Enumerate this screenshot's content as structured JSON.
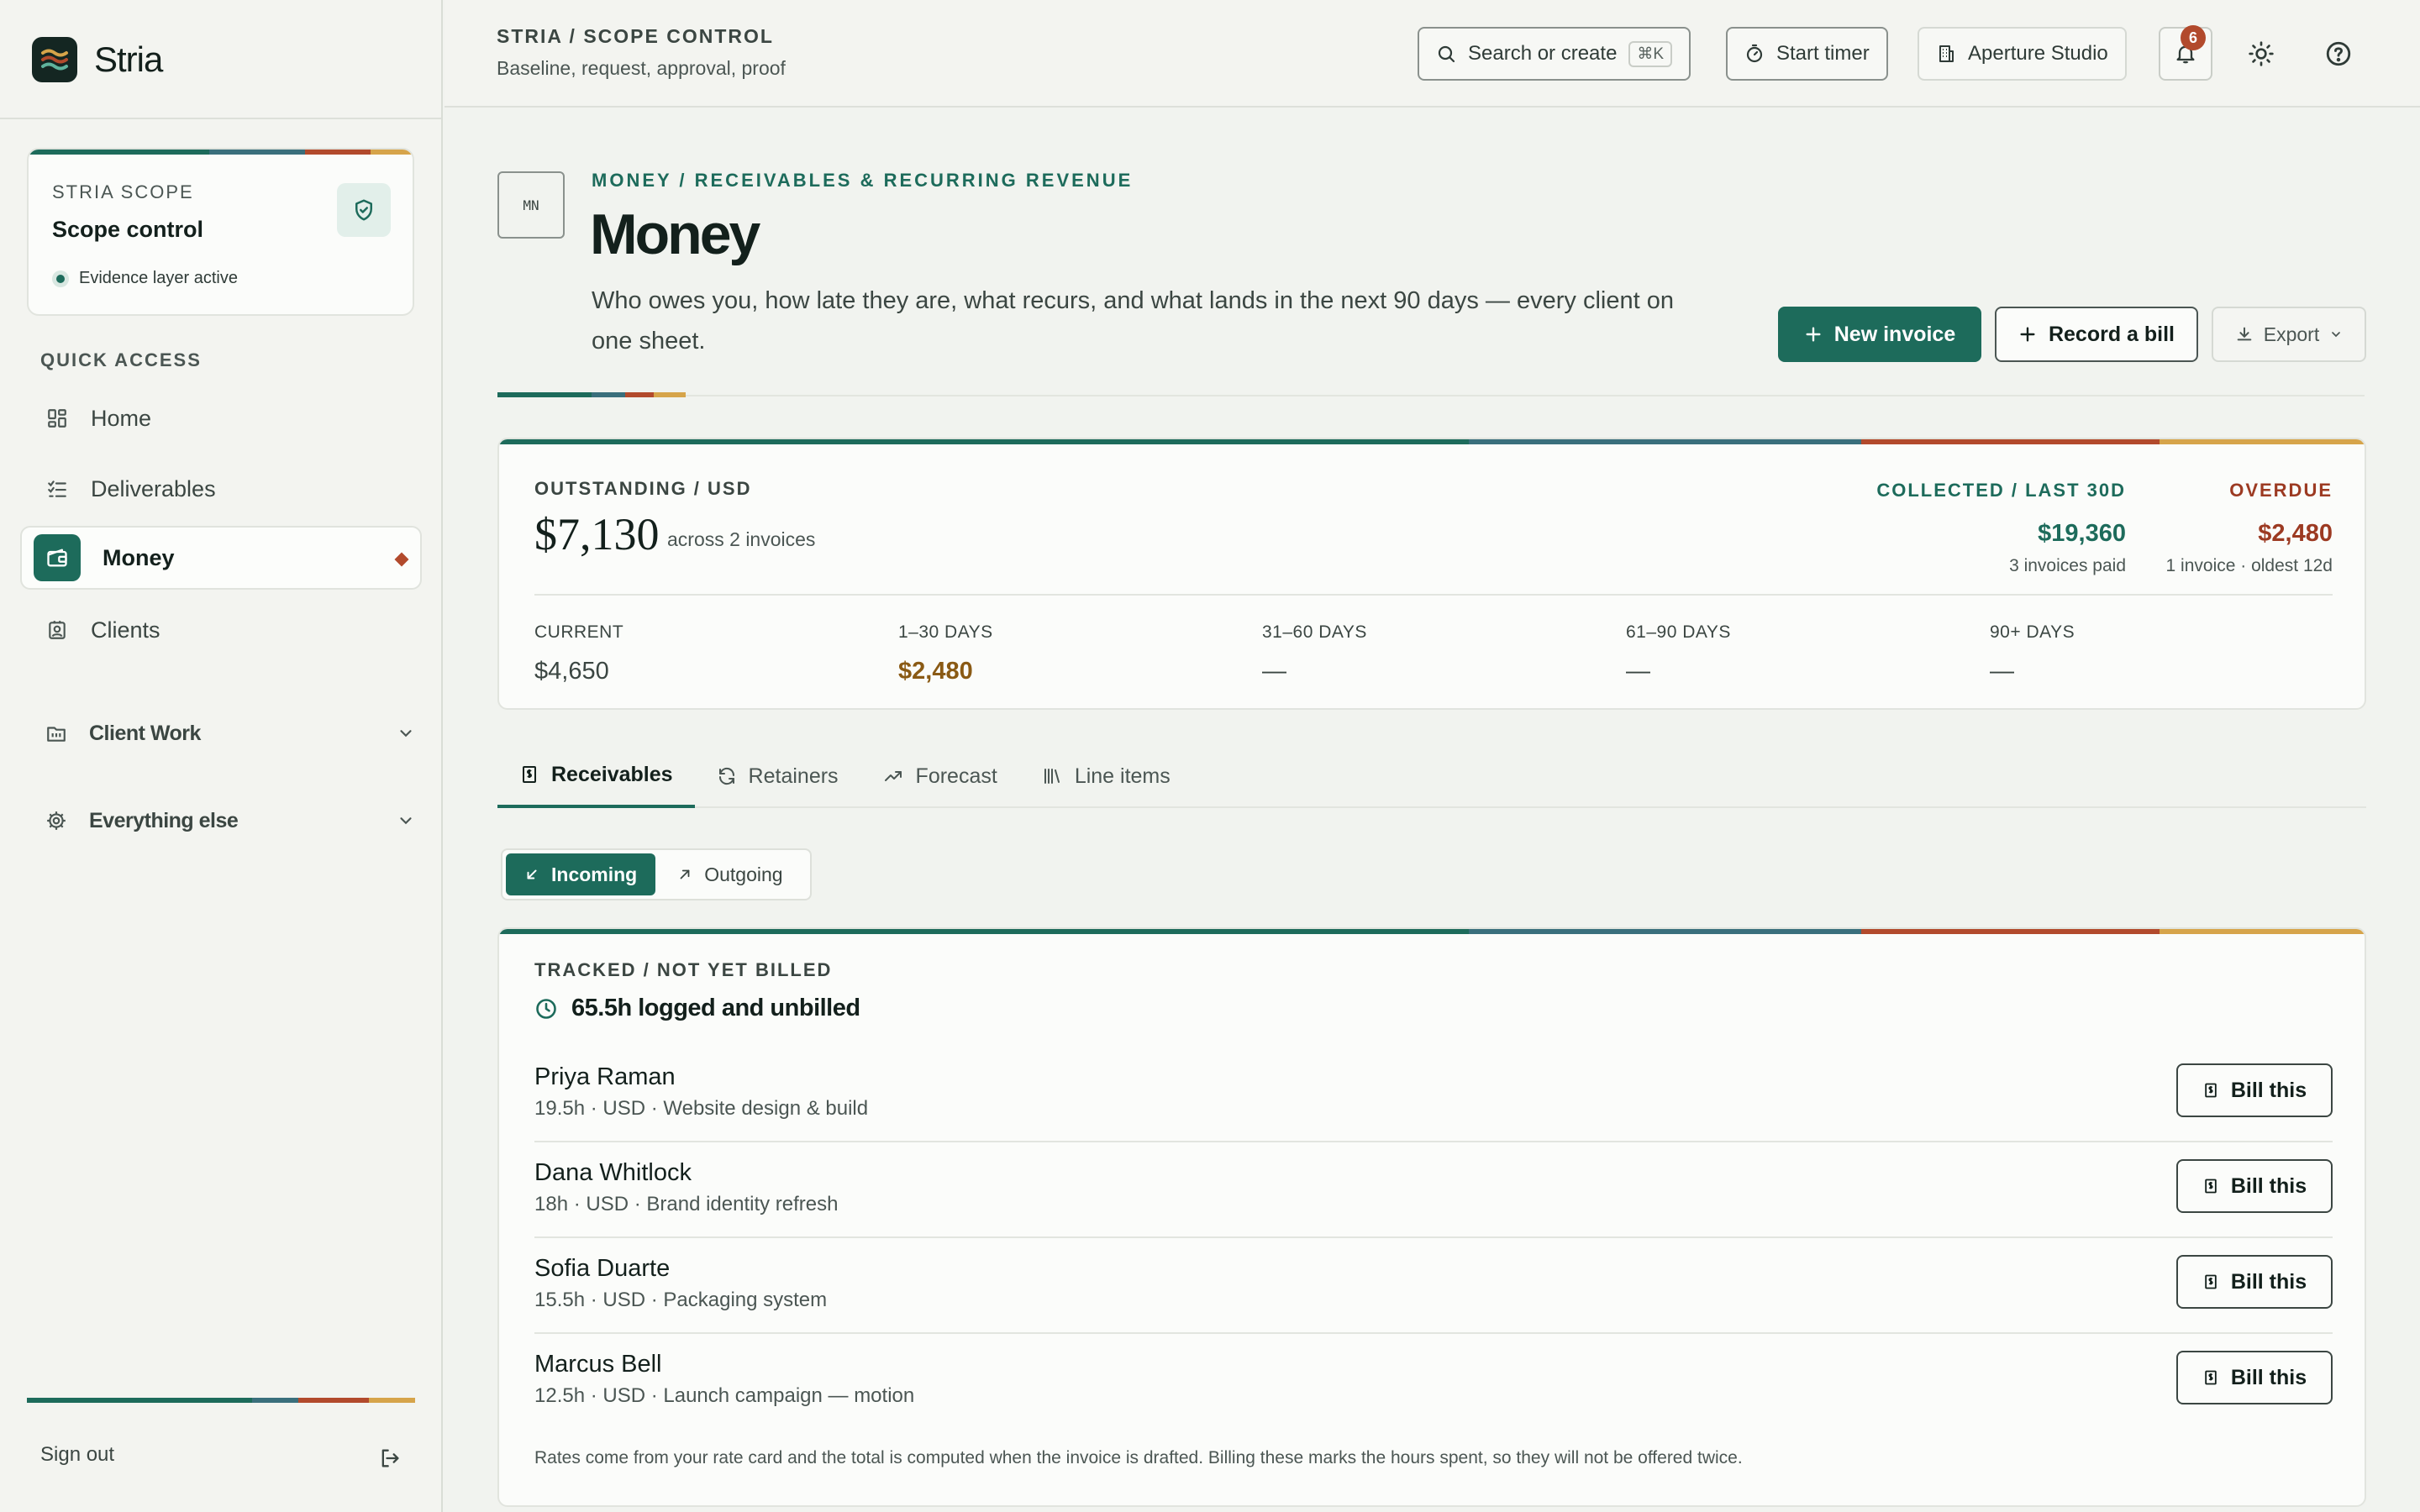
{
  "app": {
    "name": "Stria"
  },
  "sidebar": {
    "scope_card": {
      "kicker": "STRIA SCOPE",
      "title": "Scope control",
      "status": "Evidence layer active"
    },
    "quick_access_label": "QUICK ACCESS",
    "items": [
      {
        "label": "Home",
        "icon": "grid-icon"
      },
      {
        "label": "Deliverables",
        "icon": "checklist-icon"
      },
      {
        "label": "Money",
        "icon": "wallet-icon",
        "active": true
      },
      {
        "label": "Clients",
        "icon": "contact-icon"
      }
    ],
    "groups": [
      {
        "label": "Client Work",
        "icon": "folder-icon"
      },
      {
        "label": "Everything else",
        "icon": "gear-icon"
      }
    ],
    "sign_out": "Sign out"
  },
  "topbar": {
    "breadcrumb": "STRIA / SCOPE CONTROL",
    "subtitle": "Baseline, request, approval, proof",
    "search_label": "Search or create",
    "search_shortcut": "⌘K",
    "timer_label": "Start timer",
    "workspace_label": "Aperture Studio",
    "notifications_count": "6"
  },
  "page": {
    "badge": "MN",
    "kicker": "MONEY / RECEIVABLES & RECURRING REVENUE",
    "title": "Money",
    "description": "Who owes you, how late they are, what recurs, and what lands in the next 90 days — every client on one sheet.",
    "actions": {
      "new_invoice": "New invoice",
      "record_bill": "Record a bill",
      "export": "Export"
    }
  },
  "summary": {
    "outstanding_label": "OUTSTANDING / USD",
    "outstanding_amount": "$7,130",
    "outstanding_sub": "across 2 invoices",
    "collected_label": "COLLECTED / LAST 30D",
    "collected_amount": "$19,360",
    "collected_sub": "3 invoices paid",
    "overdue_label": "OVERDUE",
    "overdue_amount": "$2,480",
    "overdue_sub": "1 invoice · oldest 12d",
    "aging": [
      {
        "label": "CURRENT",
        "value": "$4,650"
      },
      {
        "label": "1–30 DAYS",
        "value": "$2,480"
      },
      {
        "label": "31–60 DAYS",
        "value": "—"
      },
      {
        "label": "61–90 DAYS",
        "value": "—"
      },
      {
        "label": "90+ DAYS",
        "value": "—"
      }
    ]
  },
  "tabs": [
    {
      "label": "Receivables",
      "icon": "receipt-icon",
      "active": true
    },
    {
      "label": "Retainers",
      "icon": "refresh-icon"
    },
    {
      "label": "Forecast",
      "icon": "trend-icon"
    },
    {
      "label": "Line items",
      "icon": "library-icon"
    }
  ],
  "direction_toggle": {
    "incoming": "Incoming",
    "outgoing": "Outgoing",
    "selected": "Incoming"
  },
  "tracked": {
    "kicker": "TRACKED / NOT YET BILLED",
    "total": "65.5h logged and unbilled",
    "bill_label": "Bill this",
    "rows": [
      {
        "name": "Priya Raman",
        "meta": "19.5h · USD · Website design & build"
      },
      {
        "name": "Dana Whitlock",
        "meta": "18h · USD · Brand identity refresh"
      },
      {
        "name": "Sofia Duarte",
        "meta": "15.5h · USD · Packaging system"
      },
      {
        "name": "Marcus Bell",
        "meta": "12.5h · USD · Launch campaign — motion"
      }
    ],
    "footnote": "Rates come from your rate card and the total is computed when the invoice is drafted. Billing these marks the hours spent, so they will not be offered twice."
  },
  "colors": {
    "accent": "#1d6b5b",
    "danger": "#b24a2c",
    "warning": "#d6a44a",
    "slate": "#3a6f7c"
  }
}
